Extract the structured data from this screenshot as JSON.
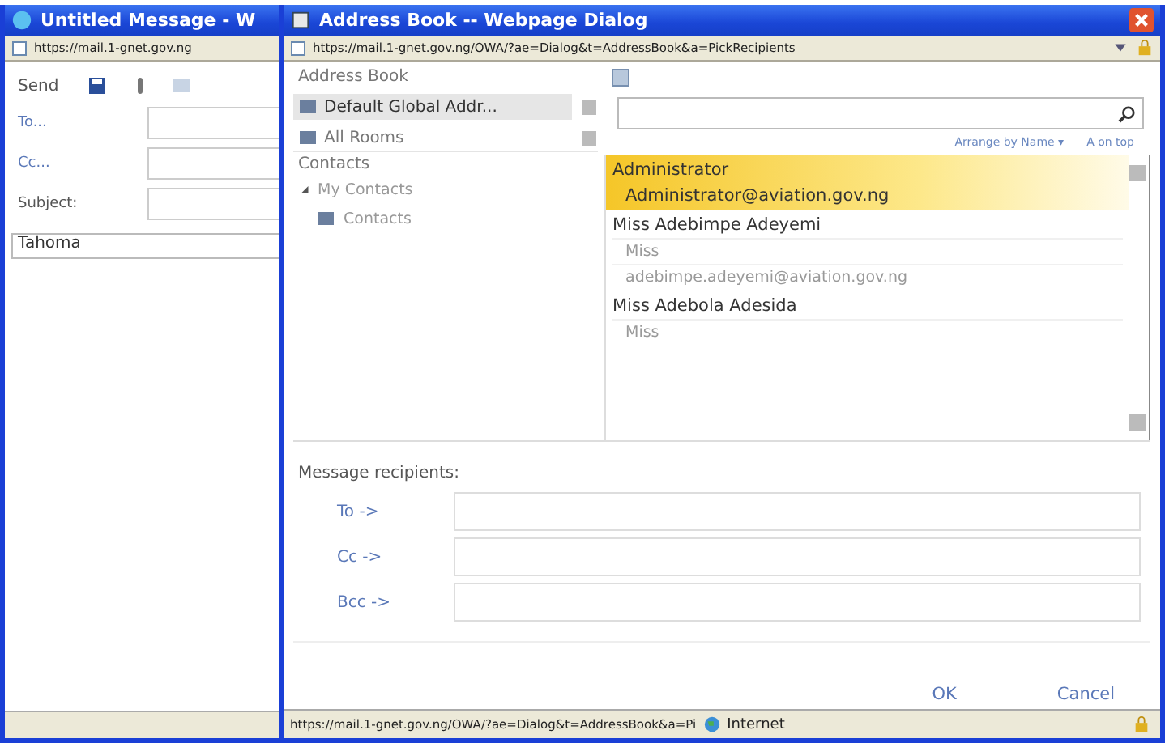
{
  "message_window": {
    "title": "Untitled Message - W",
    "address": "https://mail.1-gnet.gov.ng",
    "toolbar": {
      "send": "Send"
    },
    "fields": [
      {
        "label": "To..."
      },
      {
        "label": "Cc..."
      },
      {
        "label": "Subject:"
      }
    ],
    "font": "Tahoma"
  },
  "dialog": {
    "title": "Address Book -- Webpage Dialog",
    "address": "https://mail.1-gnet.gov.ng/OWA/?ae=Dialog&t=AddressBook&a=PickRecipients",
    "address_books": {
      "heading": "Address Book",
      "items": [
        {
          "label": "Default Global Addr...",
          "selected": true
        },
        {
          "label": "All Rooms",
          "selected": false
        }
      ]
    },
    "contacts": {
      "heading": "Contacts",
      "tree": [
        {
          "label": "My Contacts",
          "expanded": true,
          "children": [
            {
              "label": "Contacts"
            }
          ]
        }
      ]
    },
    "sort": {
      "arrange": "Arrange by Name ▾",
      "order": "A on top"
    },
    "entries": [
      {
        "name": "Administrator",
        "details": [
          "Administrator@aviation.gov.ng"
        ],
        "selected": true
      },
      {
        "name": "Miss Adebimpe Adeyemi",
        "details": [
          "Miss",
          "adebimpe.adeyemi@aviation.gov.ng"
        ],
        "selected": false
      },
      {
        "name": "Miss Adebola Adesida",
        "details": [
          "Miss"
        ],
        "selected": false
      }
    ],
    "recipients": {
      "heading": "Message recipients:",
      "rows": [
        {
          "label": "To ->"
        },
        {
          "label": "Cc ->"
        },
        {
          "label": "Bcc ->"
        }
      ]
    },
    "buttons": [
      "OK",
      "Cancel"
    ],
    "status_bar": {
      "url": "https://mail.1-gnet.gov.ng/OWA/?ae=Dialog&t=AddressBook&a=Pi",
      "zone": "Internet"
    }
  }
}
